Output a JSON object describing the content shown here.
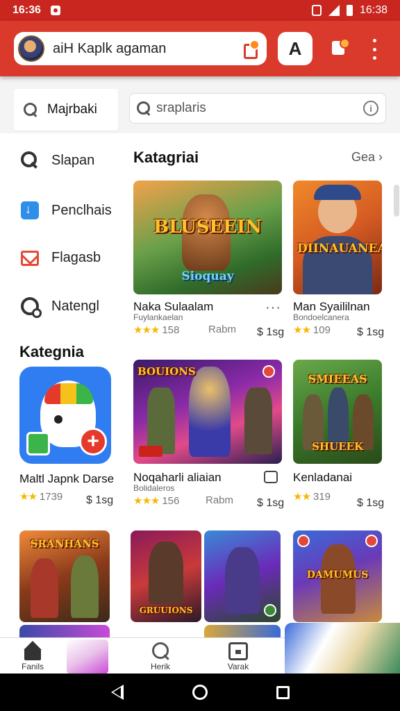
{
  "status": {
    "time_left": "16:36",
    "time_right": "16:38"
  },
  "appbar": {
    "title": "aiH Kaplk agaman",
    "action_label": "A"
  },
  "tabs": {
    "active_label": "Majrbaki"
  },
  "search": {
    "placeholder": "sraplaris"
  },
  "sidebar": {
    "items": [
      {
        "label": "Slapan",
        "icon": "search-icon"
      },
      {
        "label": "Penclhais",
        "icon": "download-icon"
      },
      {
        "label": "Flagasb",
        "icon": "mail-icon"
      },
      {
        "label": "Natengl",
        "icon": "settings-icon"
      }
    ]
  },
  "section": {
    "title": "Katagriai",
    "see_all": "Gea"
  },
  "categories_title": "Kategnia",
  "cards": [
    {
      "name": "Naka Sulaalam",
      "sub": "Fuylankaelan",
      "stars": "★★★",
      "rating": "158",
      "tag": "Rabm",
      "price": "$ 1sg",
      "art_title": "BLUSEEIN",
      "art_sub": "Sioquay"
    },
    {
      "name": "Man Syaililnan",
      "sub": "Bondoelcanera",
      "stars": "★★",
      "rating": "109",
      "tag": "",
      "price": "$ 1sg",
      "art_title": "DIINAUANEALIN",
      "art_sub": ""
    },
    {
      "name": "Noqaharli aliaian",
      "sub": "Bolidaleros",
      "stars": "★★★",
      "rating": "156",
      "tag": "Rabm",
      "price": "$ 1sg",
      "art_title": "BOUIONS",
      "art_sub": ""
    },
    {
      "name": "Kenladanai",
      "sub": "",
      "stars": "★★",
      "rating": "319",
      "tag": "",
      "price": "$ 1sg",
      "art_title": "SMIEEAS",
      "art_sub": "SHUEEK"
    }
  ],
  "featured_app": {
    "name": "Maltl Japnk Darse",
    "stars": "★★",
    "rating": "1739",
    "price": "$ 1sg"
  },
  "grid_art": [
    "SRANHANS",
    "GRUUIONS",
    "DAMUMUS"
  ],
  "bottom_nav": [
    {
      "label": "Fanils",
      "icon": "home-icon"
    },
    {
      "label": "Herik",
      "icon": "search-icon"
    },
    {
      "label": "Varak",
      "icon": "calendar-icon"
    }
  ],
  "colors": {
    "brand": "#d93a2b",
    "star": "#f6b700"
  }
}
